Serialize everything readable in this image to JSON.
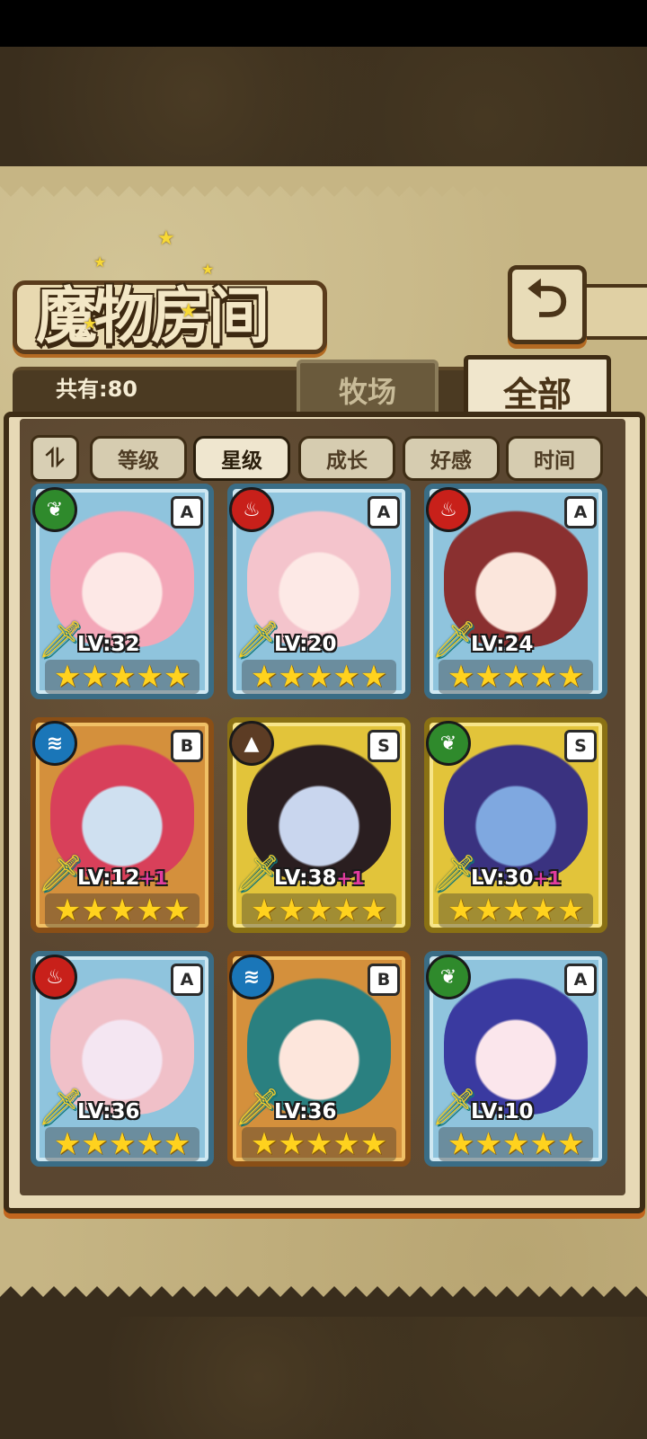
{
  "title": "魔物房间",
  "back_icon": "return-arrow-icon",
  "total_label": "共有:80",
  "tabs": [
    {
      "label": "牧场",
      "active": false
    },
    {
      "label": "全部",
      "active": true
    }
  ],
  "sort": {
    "toggle_glyph": "⥮",
    "options": [
      {
        "label": "等级",
        "active": false
      },
      {
        "label": "星级",
        "active": true
      },
      {
        "label": "成长",
        "active": false
      },
      {
        "label": "好感",
        "active": false
      },
      {
        "label": "时间",
        "active": false
      }
    ]
  },
  "monsters": [
    {
      "element": "grass",
      "element_icon": "leaf-icon",
      "rank": "A",
      "level": "LV:32",
      "bonus": "",
      "stars": 5,
      "hair": "#f3a7b8",
      "skin": "#fde8e6"
    },
    {
      "element": "fire",
      "element_icon": "flame-icon",
      "rank": "A",
      "level": "LV:20",
      "bonus": "",
      "stars": 5,
      "hair": "#f4c4cc",
      "skin": "#fde9e6"
    },
    {
      "element": "fire",
      "element_icon": "flame-icon",
      "rank": "A",
      "level": "LV:24",
      "bonus": "",
      "stars": 5,
      "hair": "#8a3030",
      "skin": "#fbe6dc"
    },
    {
      "element": "water",
      "element_icon": "water-waves-icon",
      "rank": "B",
      "level": "LV:12",
      "bonus": "+1",
      "stars": 5,
      "hair": "#d8405a",
      "skin": "#cfe0f0"
    },
    {
      "element": "earth",
      "element_icon": "mountain-icon",
      "rank": "S",
      "level": "LV:38",
      "bonus": "+1",
      "stars": 5,
      "hair": "#2a1e20",
      "skin": "#c9d6ee"
    },
    {
      "element": "grass",
      "element_icon": "leaf-icon",
      "rank": "S",
      "level": "LV:30",
      "bonus": "+1",
      "stars": 5,
      "hair": "#3a3280",
      "skin": "#7fa8e0"
    },
    {
      "element": "fire",
      "element_icon": "flame-icon",
      "rank": "A",
      "level": "LV:36",
      "bonus": "",
      "stars": 5,
      "hair": "#f0c0c8",
      "skin": "#f4e6f2"
    },
    {
      "element": "water",
      "element_icon": "water-waves-icon",
      "rank": "B",
      "level": "LV:36",
      "bonus": "",
      "stars": 5,
      "hair": "#2a8080",
      "skin": "#fde6dc"
    },
    {
      "element": "grass",
      "element_icon": "leaf-icon",
      "rank": "A",
      "level": "LV:10",
      "bonus": "",
      "stars": 5,
      "hair": "#3a3aa0",
      "skin": "#fbe6ec"
    }
  ],
  "colors": {
    "rank_A_frame": "#8fc4dd",
    "rank_B_frame": "#d4903c",
    "rank_S_frame": "#e2c43a",
    "star": "#ffd21e",
    "bonus": "#e03c9e"
  }
}
